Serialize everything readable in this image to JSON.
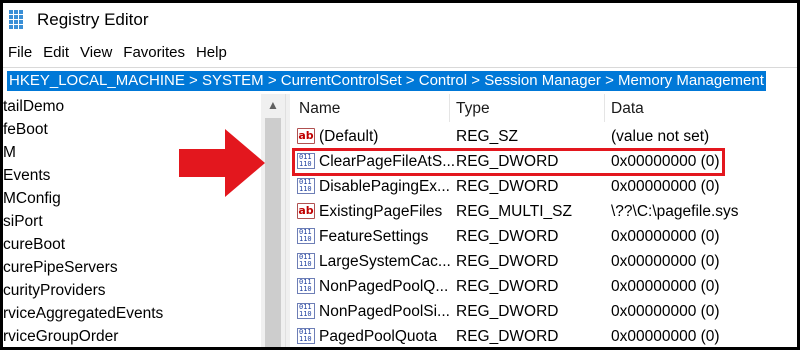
{
  "window": {
    "title": "Registry Editor"
  },
  "menu": [
    "File",
    "Edit",
    "View",
    "Favorites",
    "Help"
  ],
  "address": "HKEY_LOCAL_MACHINE > SYSTEM > CurrentControlSet > Control > Session Manager > Memory Management",
  "tree": [
    "tailDemo",
    "feBoot",
    "M",
    "Events",
    "MConfig",
    "siPort",
    "cureBoot",
    "curePipeServers",
    "curityProviders",
    "rviceAggregatedEvents",
    "rviceGroupOrder"
  ],
  "columns": {
    "name": "Name",
    "type": "Type",
    "data": "Data"
  },
  "values": [
    {
      "icon": "string-value-icon",
      "name": "(Default)",
      "type": "REG_SZ",
      "data": "(value not set)"
    },
    {
      "icon": "binary-value-icon",
      "name": "ClearPageFileAtS...",
      "type": "REG_DWORD",
      "data": "0x00000000 (0)"
    },
    {
      "icon": "binary-value-icon",
      "name": "DisablePagingEx...",
      "type": "REG_DWORD",
      "data": "0x00000000 (0)"
    },
    {
      "icon": "string-value-icon",
      "name": "ExistingPageFiles",
      "type": "REG_MULTI_SZ",
      "data": "\\??\\C:\\pagefile.sys"
    },
    {
      "icon": "binary-value-icon",
      "name": "FeatureSettings",
      "type": "REG_DWORD",
      "data": "0x00000000 (0)"
    },
    {
      "icon": "binary-value-icon",
      "name": "LargeSystemCac...",
      "type": "REG_DWORD",
      "data": "0x00000000 (0)"
    },
    {
      "icon": "binary-value-icon",
      "name": "NonPagedPoolQ...",
      "type": "REG_DWORD",
      "data": "0x00000000 (0)"
    },
    {
      "icon": "binary-value-icon",
      "name": "NonPagedPoolSi...",
      "type": "REG_DWORD",
      "data": "0x00000000 (0)"
    },
    {
      "icon": "binary-value-icon",
      "name": "PagedPoolQuota",
      "type": "REG_DWORD",
      "data": "0x00000000 (0)"
    }
  ],
  "colors": {
    "selection": "#0078d7",
    "annotation": "#e3171e"
  },
  "annotation": {
    "highlighted_value": "ClearPageFileAtS..."
  }
}
